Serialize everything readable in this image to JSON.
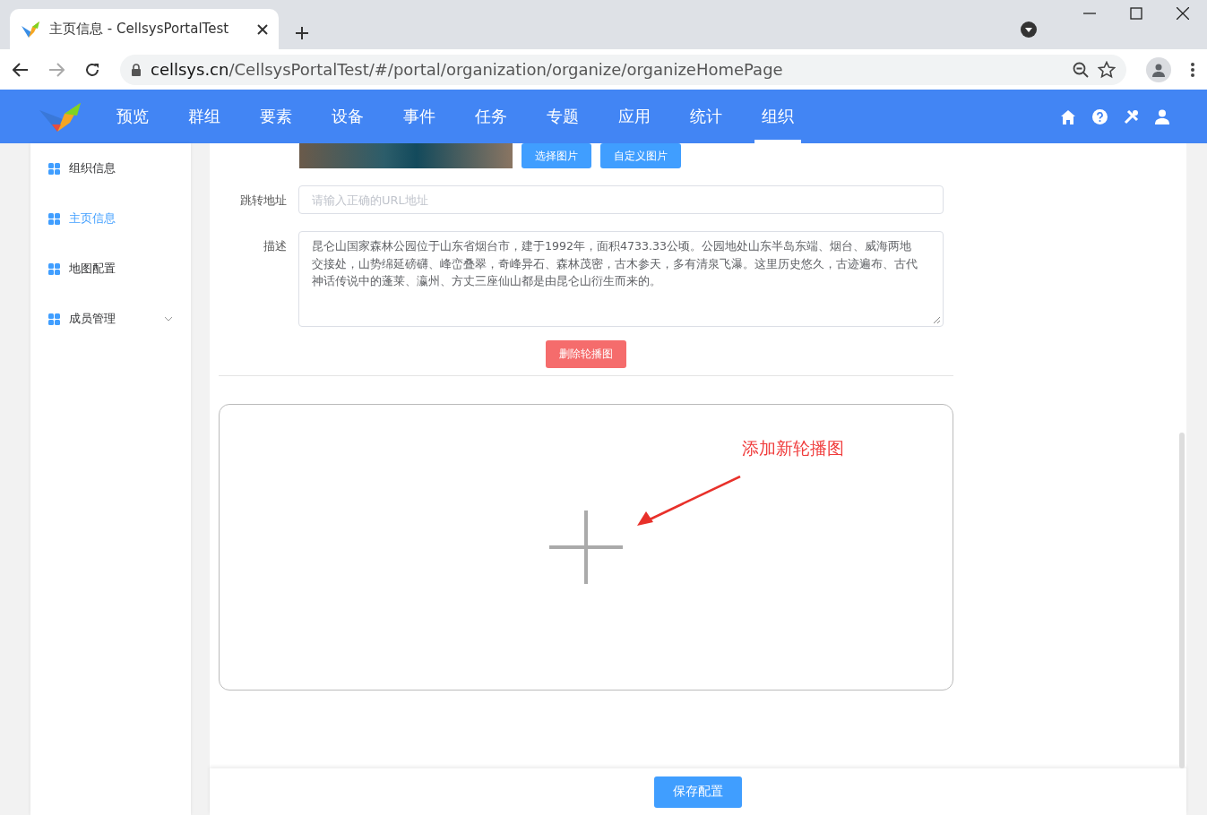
{
  "browser": {
    "tab_title": "主页信息 - CellsysPortalTest",
    "url_host": "cellsys.cn",
    "url_path": "/CellsysPortalTest/#/portal/organization/organize/organizeHomePage"
  },
  "nav": {
    "items": [
      {
        "label": "预览",
        "selected": false
      },
      {
        "label": "群组",
        "selected": false
      },
      {
        "label": "要素",
        "selected": false
      },
      {
        "label": "设备",
        "selected": false
      },
      {
        "label": "事件",
        "selected": false
      },
      {
        "label": "任务",
        "selected": false
      },
      {
        "label": "专题",
        "selected": false
      },
      {
        "label": "应用",
        "selected": false
      },
      {
        "label": "统计",
        "selected": false
      },
      {
        "label": "组织",
        "selected": true
      }
    ]
  },
  "sidebar": {
    "items": [
      {
        "label": "组织信息",
        "selected": false,
        "kind": "item"
      },
      {
        "label": "主页信息",
        "selected": true,
        "kind": "item"
      },
      {
        "label": "地图配置",
        "selected": false,
        "kind": "item"
      },
      {
        "label": "成员管理",
        "selected": false,
        "kind": "submenu"
      }
    ]
  },
  "form": {
    "image_buttons": [
      "选择图片",
      "自定义图片"
    ],
    "url_field": {
      "label": "跳转地址",
      "placeholder": "请输入正确的URL地址"
    },
    "description": {
      "label": "描述",
      "value": "昆仑山国家森林公园位于山东省烟台市，建于1992年，面积4733.33公顷。公园地处山东半岛东端、烟台、威海两地交接处，山势绵延磅礴、峰峦叠翠，奇峰异石、森林茂密，古木参天，多有清泉飞瀑。这里历史悠久，古迹遍布、古代神话传说中的蓬莱、瀛州、方丈三座仙山都是由昆仑山衍生而来的。"
    },
    "delete_button": "删除轮播图",
    "add_area": {
      "annotation": "添加新轮播图"
    },
    "save_button": "保存配置"
  }
}
